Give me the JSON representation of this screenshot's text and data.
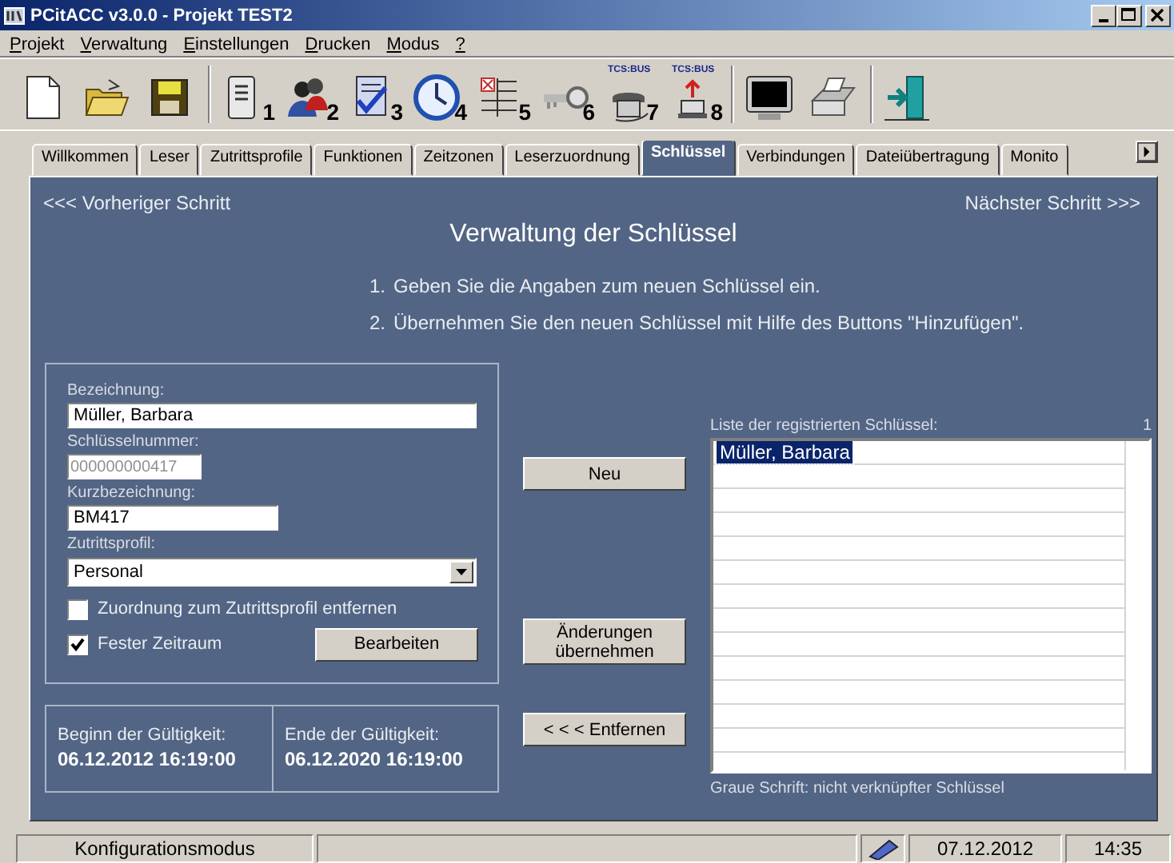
{
  "window": {
    "title": "PCitACC v3.0.0 - Projekt TEST2"
  },
  "menu": [
    "Projekt",
    "Verwaltung",
    "Einstellungen",
    "Drucken",
    "Modus",
    "?"
  ],
  "toolbar": [
    [
      {
        "kind": "document"
      },
      {
        "kind": "folder"
      },
      {
        "kind": "floppy"
      }
    ],
    [
      {
        "kind": "reader",
        "badge": "1"
      },
      {
        "kind": "people",
        "badge": "2"
      },
      {
        "kind": "checklist",
        "badge": "3"
      },
      {
        "kind": "clock",
        "badge": "4"
      },
      {
        "kind": "grid",
        "badge": "5"
      },
      {
        "kind": "key",
        "badge": "6"
      },
      {
        "kind": "phone",
        "badge": "7",
        "caption": "TCS:BUS"
      },
      {
        "kind": "upload",
        "badge": "8",
        "caption": "TCS:BUS"
      }
    ],
    [
      {
        "kind": "monitor"
      },
      {
        "kind": "printer"
      }
    ],
    [
      {
        "kind": "exit"
      }
    ]
  ],
  "tabs": [
    {
      "label": "Willkommen",
      "selected": false
    },
    {
      "label": "Leser",
      "selected": false
    },
    {
      "label": "Zutrittsprofile",
      "selected": false
    },
    {
      "label": "Funktionen",
      "selected": false
    },
    {
      "label": "Zeitzonen",
      "selected": false
    },
    {
      "label": "Leserzuordnung",
      "selected": false
    },
    {
      "label": "Schlüssel",
      "selected": true
    },
    {
      "label": "Verbindungen",
      "selected": false
    },
    {
      "label": "Dateiübertragung",
      "selected": false
    },
    {
      "label": "Monito",
      "selected": false
    }
  ],
  "nav": {
    "previous": "<<< Vorheriger Schritt",
    "next": "Nächster Schritt >>>"
  },
  "heading": "Verwaltung der Schlüssel",
  "steps": [
    {
      "number": "1.",
      "text": "Geben Sie die Angaben zum neuen Schlüssel ein."
    },
    {
      "number": "2.",
      "text": "Übernehmen Sie den neuen Schlüssel mit Hilfe des Buttons \"Hinzufügen\"."
    }
  ],
  "form": {
    "fields": [
      {
        "label": "Bezeichnung:",
        "value": "Müller, Barbara",
        "disabled": false
      },
      {
        "label": "Schlüsselnummer:",
        "value": "000000000417",
        "disabled": true
      },
      {
        "label": "Kurzbezeichnung:",
        "value": "BM417",
        "disabled": false
      }
    ],
    "profile": {
      "label": "Zutrittsprofil:",
      "value": "Personal"
    },
    "checkboxes": [
      {
        "label": "Zuordnung zum Zutrittsprofil entfernen",
        "checked": false
      },
      {
        "label": "Fester Zeitraum",
        "checked": true
      }
    ],
    "edit_button": "Bearbeiten"
  },
  "validity": [
    {
      "label": "Beginn der Gültigkeit:",
      "value": "06.12.2012 16:19:00"
    },
    {
      "label": "Ende der Gültigkeit:",
      "value": "06.12.2020 16:19:00"
    }
  ],
  "actions": [
    "Neu",
    "Änderungen übernehmen",
    "< < < Entfernen"
  ],
  "key_list": {
    "label": "Liste der registrierten Schlüssel:",
    "count": "1",
    "items": [
      {
        "name": "Müller, Barbara",
        "selected": true
      }
    ],
    "note": "Graue Schrift: nicht verknüpfter Schlüssel"
  },
  "status_bar": {
    "mode": "Konfigurationsmodus",
    "date": "07.12.2012",
    "time": "14:35"
  }
}
